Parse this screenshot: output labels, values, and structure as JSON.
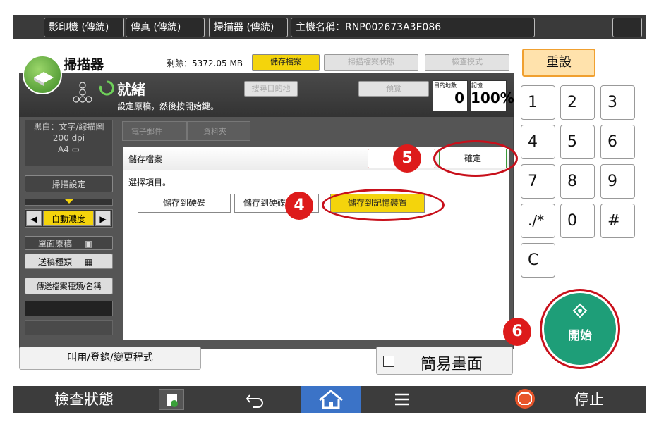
{
  "topbar": {
    "tabs": [
      "影印機 (傳統)",
      "傳真 (傳統)",
      "掃描器 (傳統)"
    ],
    "host_label": "主機名稱：RNP002673A3E086",
    "moon_icon": "moon-icon"
  },
  "scanner": {
    "title": "掃描器",
    "remaining": "剩餘：5372.05 MB",
    "btn_store": "儲存檔案",
    "btn_scan_status": "掃描檔案狀態",
    "btn_check_mode": "檢查模式",
    "status_title": "就緒",
    "status_sub": "設定原稿，然後按開始鍵。",
    "btn_search_dest": "搜尋目的地",
    "btn_preview": "預覽",
    "dest_count_label": "目的地數",
    "dest_count": "0",
    "memory_label": "記憶",
    "memory_value": "100%"
  },
  "left_panel": {
    "mode": "黑白：文字/線描圖",
    "dpi": "200 dpi",
    "paper": "A4",
    "scan_settings": "掃描設定",
    "density": "自動濃度",
    "single_side": "單面原稿",
    "feed_type": "送稿種類",
    "file_type": "傳送檔案種類/名稱",
    "tab_email": "電子郵件",
    "tab_folder": "資料夾"
  },
  "dialog": {
    "title": "儲存檔案",
    "ok": "確定",
    "prompt": "選擇項目。",
    "opt_hdd": "儲存到硬碟",
    "opt_hdd_send": "儲存到硬碟",
    "opt_memory": "儲存到記憶裝置"
  },
  "keypad": {
    "reset": "重設",
    "keys": [
      "1",
      "2",
      "3",
      "4",
      "5",
      "6",
      "7",
      "8",
      "9",
      "./*",
      "0",
      "#",
      "C"
    ],
    "start": "開始"
  },
  "bottom": {
    "program_btn": "叫用/登錄/變更程式",
    "simple_screen": "簡易畫面",
    "check_status": "檢查狀態",
    "stop": "停止"
  },
  "annotations": {
    "a4": "4",
    "a5": "5",
    "a6": "6"
  },
  "colors": {
    "accent_yellow": "#f4d40c",
    "start_green": "#1e9e78",
    "highlight_red": "#c8101b",
    "home_blue": "#3b73c7"
  }
}
